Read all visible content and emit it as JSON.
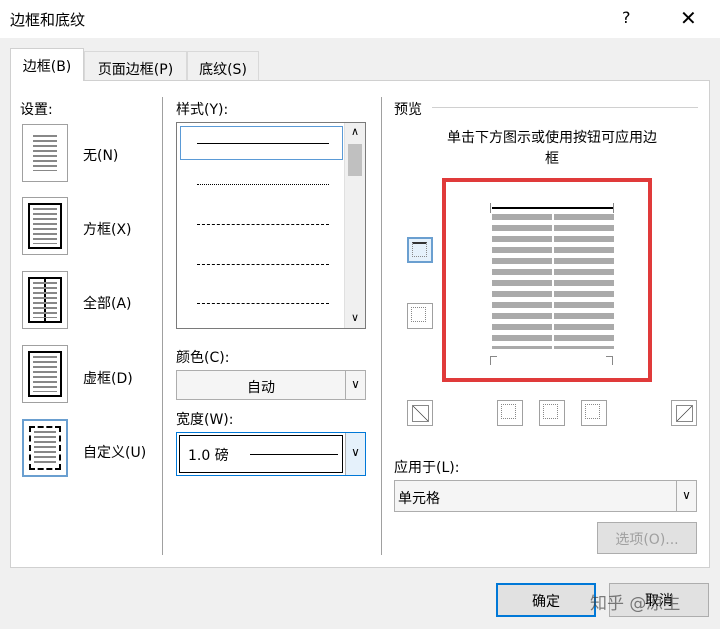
{
  "window": {
    "title": "边框和底纹",
    "help": "?",
    "close": "✕"
  },
  "tabs": [
    {
      "label": "边框(B)"
    },
    {
      "label": "页面边框(P)"
    },
    {
      "label": "底纹(S)"
    }
  ],
  "settings": {
    "label": "设置:",
    "items": [
      {
        "label": "无(N)"
      },
      {
        "label": "方框(X)"
      },
      {
        "label": "全部(A)"
      },
      {
        "label": "虚框(D)"
      },
      {
        "label": "自定义(U)"
      }
    ],
    "selected": "自定义(U)"
  },
  "style": {
    "label": "样式(Y):",
    "options": [
      "solid",
      "dotted",
      "dashed-fine",
      "dashed",
      "dash-dot"
    ],
    "selected": "solid"
  },
  "color": {
    "label": "颜色(C):",
    "value": "自动"
  },
  "width": {
    "label": "宽度(W):",
    "value": "1.0 磅"
  },
  "preview": {
    "label": "预览",
    "hint": "单击下方图示或使用按钮可应用边框",
    "highlight_color": "#e03a3a"
  },
  "apply_to": {
    "label": "应用于(L):",
    "value": "单元格"
  },
  "buttons": {
    "options": "选项(O)...",
    "ok": "确定",
    "cancel": "取消"
  },
  "watermark": "知乎 @凉生"
}
